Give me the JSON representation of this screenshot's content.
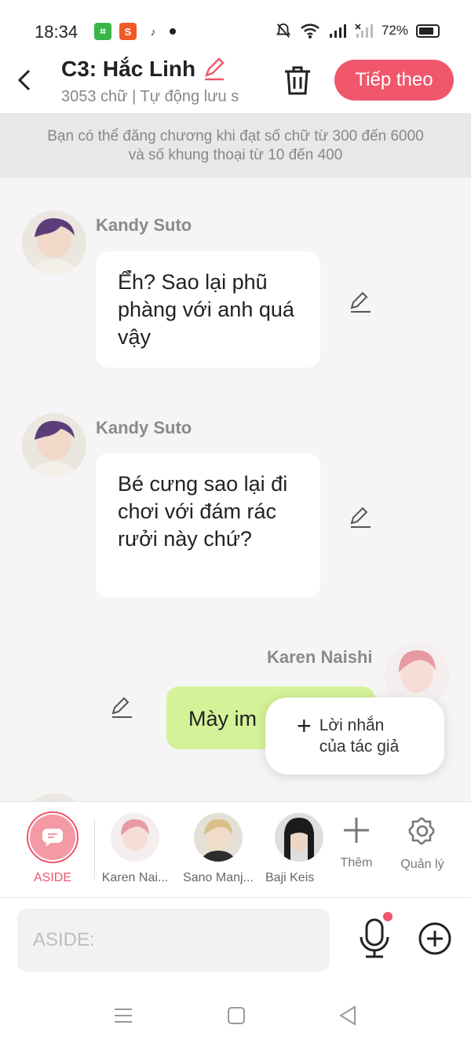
{
  "status_bar": {
    "time": "18:34",
    "battery": "72%"
  },
  "header": {
    "title": "C3: Hắc Linh",
    "subtitle": "3053 chữ | Tự động lưu s",
    "next_label": "Tiếp theo"
  },
  "notice": {
    "text": "Bạn có thể đăng chương khi đạt số chữ từ 300 đến 6000 và số khung thoại từ 10 đến 400"
  },
  "messages": [
    {
      "sender": "Kandy Suto",
      "text": "Ể̉h? Sao lại phũ phàng với anh quá vậy"
    },
    {
      "sender": "Kandy Suto",
      "text": "Bé cưng sao lại đi chơi với đám rác rưởi này chứ?"
    },
    {
      "sender": "Karen Naishi",
      "text": "Mày im"
    }
  ],
  "popup": {
    "line1": "Lời nhắn",
    "line2": "của tác giả"
  },
  "character_bar": {
    "aside_label": "ASIDE",
    "characters": [
      {
        "name": "Karen Nai..."
      },
      {
        "name": "Sano Manj..."
      },
      {
        "name": "Baji Keis"
      }
    ],
    "add_label": "Thêm",
    "manage_label": "Quản lý"
  },
  "input": {
    "placeholder": "ASIDE:"
  },
  "colors": {
    "accent": "#f0566c",
    "my_bubble": "#d4f298",
    "notice_bg": "#e8e8e8"
  }
}
